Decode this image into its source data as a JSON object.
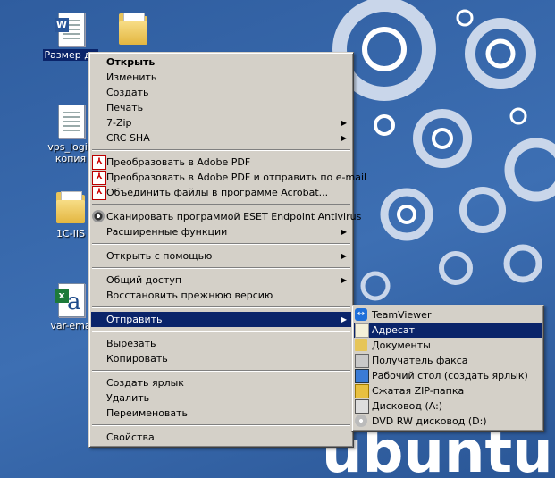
{
  "desktop": {
    "icons": [
      {
        "label": "Размер до"
      },
      {
        "label": "vps_login"
      },
      {
        "label": "копия"
      },
      {
        "label": "1C-IIS"
      },
      {
        "label": "var-ema"
      }
    ],
    "wallpaper_text": "ubuntu"
  },
  "context_menu": {
    "open": "Открыть",
    "edit": "Изменить",
    "create": "Создать",
    "print": "Печать",
    "zip7": "7-Zip",
    "crc": "CRC SHA",
    "pdf_convert": "Преобразовать в Adobe PDF",
    "pdf_email": "Преобразовать в Adobe PDF и отправить по e-mail",
    "pdf_combine": "Объединить файлы в программе Acrobat...",
    "eset_scan": "Сканировать программой ESET Endpoint Antivirus",
    "advanced": "Расширенные функции",
    "open_with": "Открыть с помощью",
    "share": "Общий доступ",
    "restore": "Восстановить прежнюю версию",
    "send_to": "Отправить",
    "cut": "Вырезать",
    "copy": "Копировать",
    "shortcut": "Создать ярлык",
    "delete": "Удалить",
    "rename": "Переименовать",
    "properties": "Свойства"
  },
  "send_to_menu": {
    "teamviewer": "TeamViewer",
    "recipient": "Адресат",
    "documents": "Документы",
    "fax": "Получатель факса",
    "desktop_shortcut": "Рабочий стол (создать ярлык)",
    "zip": "Сжатая ZIP-папка",
    "floppy": "Дисковод (A:)",
    "dvd": "DVD RW дисковод (D:)"
  },
  "colors": {
    "highlight": "#0a246a",
    "menu_bg": "#d4d0c8",
    "desktop_bg": "#3a66a8"
  }
}
